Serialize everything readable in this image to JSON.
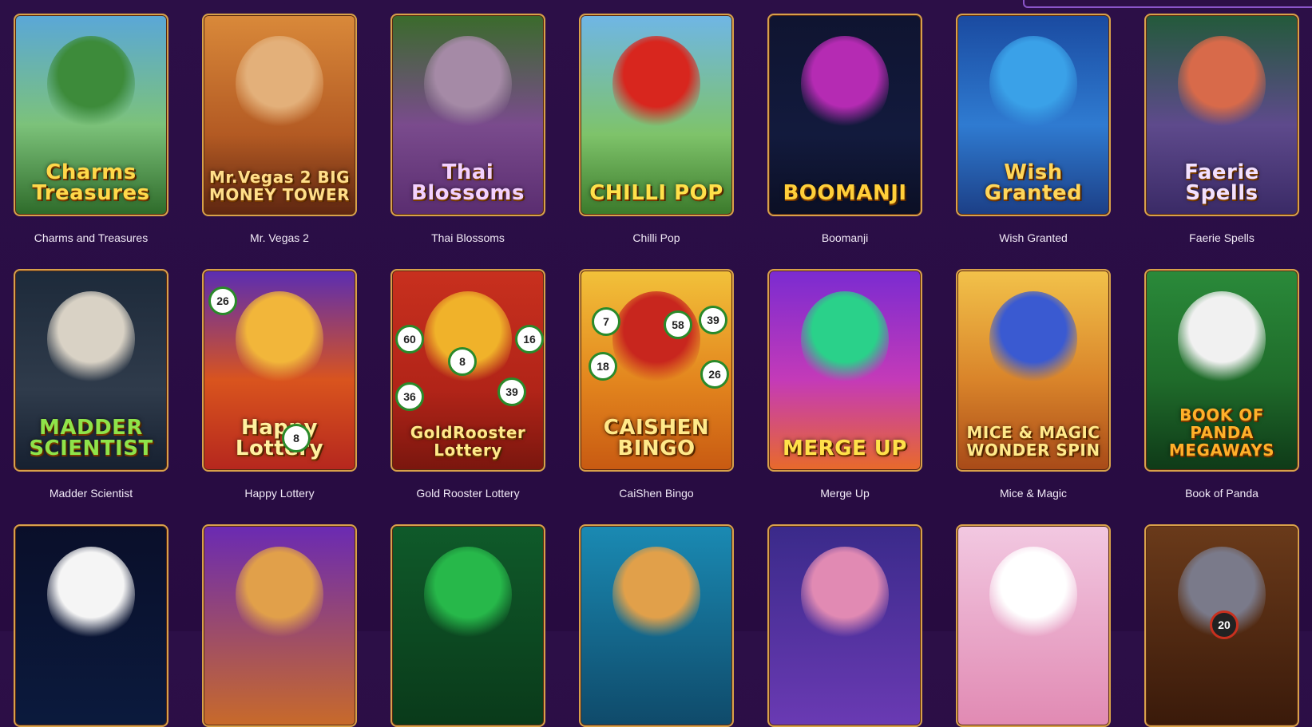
{
  "games": [
    {
      "title": "Charms and Treasures",
      "logo": "Charms Treasures",
      "bg": "linear-gradient(180deg,#5aa7d8 0%,#7cc27a 55%,#2e6b2a 100%)",
      "art": "#3d8b3a",
      "logo_color": "#ffd84a"
    },
    {
      "title": "Mr. Vegas 2",
      "logo": "Mr.Vegas 2 BIG MONEY TOWER",
      "bg": "linear-gradient(180deg,#d9893a 0%,#b35a23 60%,#5e2611 100%)",
      "art": "#e3b07a",
      "logo_color": "#ffdf8a"
    },
    {
      "title": "Thai Blossoms",
      "logo": "Thai Blossoms",
      "bg": "linear-gradient(180deg,#3a6b2b 0%,#7a4b8d 55%,#5a2d70 100%)",
      "art": "#a58aa6",
      "logo_color": "#f3d1ff"
    },
    {
      "title": "Chilli Pop",
      "logo": "CHILLI POP",
      "bg": "linear-gradient(180deg,#6fb6e6 0%,#7ec36a 60%,#3b7a2b 100%)",
      "art": "#d8261e",
      "logo_color": "#ffe14a"
    },
    {
      "title": "Boomanji",
      "logo": "BOOMANJI",
      "bg": "linear-gradient(180deg,#0f1430 0%,#121a3d 60%,#0b0f24 100%)",
      "art": "#b52bb3",
      "logo_color": "#ffcf3a"
    },
    {
      "title": "Wish Granted",
      "logo": "Wish Granted",
      "bg": "linear-gradient(180deg,#1a4aa0 0%,#2f7bd1 55%,#1c3f86 100%)",
      "art": "#3aa1e8",
      "logo_color": "#ffd65a"
    },
    {
      "title": "Faerie Spells",
      "logo": "Faerie Spells",
      "bg": "linear-gradient(180deg,#235a3a 0%,#5e4a8c 55%,#3a2a66 100%)",
      "art": "#d86a4a",
      "logo_color": "#f3e1ff"
    },
    {
      "title": "Madder Scientist",
      "logo": "MADDER SCIENTIST",
      "bg": "linear-gradient(180deg,#1d2a3a 0%,#2f3b4b 60%,#162030 100%)",
      "art": "#d9d2c5",
      "logo_color": "#8fe34a"
    },
    {
      "title": "Happy Lottery",
      "logo": "Happy Lottery",
      "bg": "linear-gradient(180deg,#5a2db3 0%,#d9541e 55%,#b5271e 100%)",
      "art": "#f2b63a",
      "logo_color": "#fff1a0"
    },
    {
      "title": "Gold Rooster Lottery",
      "logo": "GoldRooster Lottery",
      "bg": "linear-gradient(180deg,#c8301e 0%,#b12418 60%,#7a160e 100%)",
      "art": "#f0b22a",
      "logo_color": "#ffe98a"
    },
    {
      "title": "CaiShen Bingo",
      "logo": "CAISHEN BINGO",
      "bg": "linear-gradient(180deg,#f2c13a 0%,#e3861e 55%,#c85a12 100%)",
      "art": "#c8261e",
      "logo_color": "#ffe98a"
    },
    {
      "title": "Merge Up",
      "logo": "MERGE UP",
      "bg": "linear-gradient(180deg,#7a2bd1 0%,#c43ab8 55%,#e86a2a 100%)",
      "art": "#2ad18a",
      "logo_color": "#ffe14a"
    },
    {
      "title": "Mice & Magic",
      "logo": "MICE & MAGIC WONDER SPIN",
      "bg": "linear-gradient(180deg,#f2c24a 0%,#d9842a 55%,#a84a18 100%)",
      "art": "#3a5ad1",
      "logo_color": "#ffe98a"
    },
    {
      "title": "Book of Panda",
      "logo": "BOOK OF PANDA MEGAWAYS",
      "bg": "linear-gradient(180deg,#2a8a3a 0%,#1f6b2a 55%,#0f3a18 100%)",
      "art": "#f1f1f1",
      "logo_color": "#ffb02a"
    },
    {
      "title": "",
      "logo": "",
      "bg": "linear-gradient(180deg,#0a0f2a 0%,#0b1a3d 100%)",
      "art": "#f5f5f5",
      "logo_color": "#ffffff"
    },
    {
      "title": "",
      "logo": "",
      "bg": "linear-gradient(180deg,#6a2ab3 0%,#c86a2a 100%)",
      "art": "#e1a04a",
      "logo_color": "#ffffff"
    },
    {
      "title": "",
      "logo": "",
      "bg": "linear-gradient(180deg,#0f5a2a 0%,#0a3a1a 100%)",
      "art": "#27b84a",
      "logo_color": "#ffffff"
    },
    {
      "title": "",
      "logo": "",
      "bg": "linear-gradient(180deg,#1a8ab3 0%,#0f4a6a 100%)",
      "art": "#e1a04a",
      "logo_color": "#ffffff"
    },
    {
      "title": "",
      "logo": "",
      "bg": "linear-gradient(180deg,#3a2a8a 0%,#6a3ab3 100%)",
      "art": "#e18ab3",
      "logo_color": "#ffffff"
    },
    {
      "title": "",
      "logo": "",
      "bg": "linear-gradient(180deg,#f2c8e1 0%,#e18ab3 100%)",
      "art": "#ffffff",
      "logo_color": "#ffffff"
    },
    {
      "title": "",
      "logo": "",
      "bg": "linear-gradient(180deg,#6a3a1a 0%,#3a1a0a 100%)",
      "art": "#7a7a8a",
      "logo_color": "#ffffff"
    }
  ],
  "balls": {
    "happy_lottery": [
      "26",
      "8"
    ],
    "gold_rooster": [
      "60",
      "8",
      "16",
      "36",
      "39"
    ],
    "caishen": [
      "7",
      "58",
      "39",
      "18",
      "26"
    ],
    "row3_last": "20"
  }
}
